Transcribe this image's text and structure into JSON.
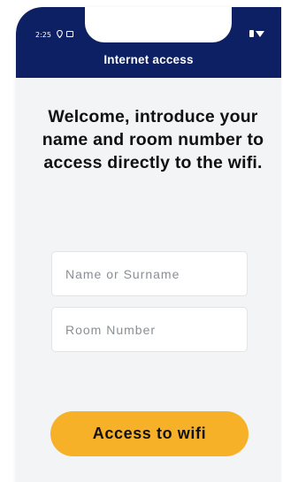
{
  "status_bar": {
    "time": "2:25",
    "icons": [
      "location-icon",
      "message-icon",
      "battery-icon",
      "wifi-icon"
    ]
  },
  "header": {
    "title": "Internet access",
    "background_color": "#0c2063"
  },
  "welcome_text": "Welcome, introduce your name and room number to access directly to the wifi.",
  "form": {
    "name_placeholder": "Name or Surname",
    "room_placeholder": "Room Number",
    "submit_label": "Access to wifi",
    "button_color": "#f7b128"
  }
}
